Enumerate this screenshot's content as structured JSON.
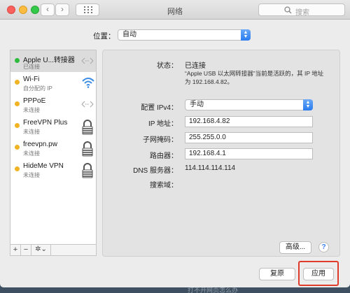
{
  "window": {
    "title": "网络",
    "search_placeholder": "搜索"
  },
  "location": {
    "label": "位置：",
    "value": "自动"
  },
  "services": [
    {
      "name": "Apple U...转接器",
      "status": "已连接",
      "state": "green",
      "icon": "ethernet-arrows-icon"
    },
    {
      "name": "Wi-Fi",
      "status": "自分配的 IP",
      "state": "yellow",
      "icon": "wifi-icon"
    },
    {
      "name": "PPPoE",
      "status": "未连接",
      "state": "yellow",
      "icon": "ethernet-arrows-icon"
    },
    {
      "name": "FreeVPN Plus",
      "status": "未连接",
      "state": "yellow",
      "icon": "lock-icon"
    },
    {
      "name": "freevpn.pw",
      "status": "未连接",
      "state": "yellow",
      "icon": "lock-icon"
    },
    {
      "name": "HideMe VPN",
      "status": "未连接",
      "state": "yellow",
      "icon": "lock-icon"
    }
  ],
  "sidebar_actions": {
    "add": "+",
    "remove": "−",
    "gear": "✲⌄"
  },
  "detail": {
    "status_label": "状态：",
    "status_value": "已连接",
    "status_desc": "“Apple USB 以太网转接器”当前是活跃的，其 IP 地址为 192.168.4.82。",
    "configure_label": "配置 IPv4：",
    "configure_value": "手动",
    "ip_label": "IP 地址：",
    "ip_value": "192.168.4.82",
    "subnet_label": "子网掩码：",
    "subnet_value": "255.255.0.0",
    "router_label": "路由器：",
    "router_value": "192.168.4.1",
    "dns_label": "DNS 服务器：",
    "dns_value": "114.114.114.114",
    "search_domain_label": "搜索域："
  },
  "buttons": {
    "advanced": "高级...",
    "help": "?",
    "revert": "复原",
    "apply": "应用"
  },
  "background_caption": "打不开网页怎么办",
  "colors": {
    "connected": "#2dbb3e",
    "not_connected": "#f0b323",
    "accent": "#2a7cf0",
    "highlight": "#e03a2a"
  }
}
